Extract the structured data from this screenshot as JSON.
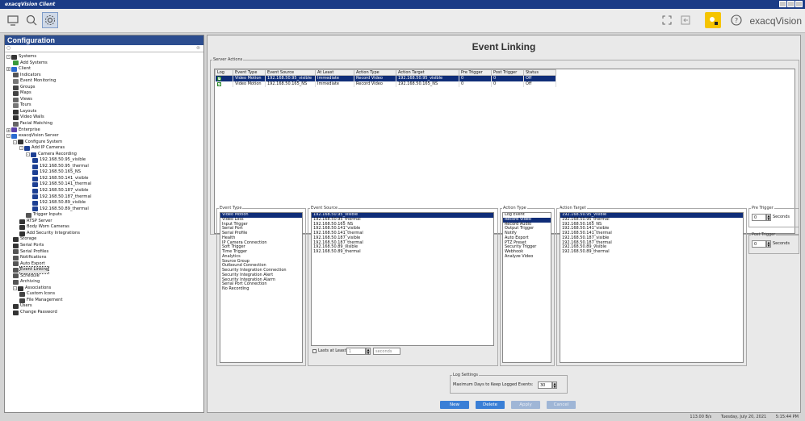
{
  "window": {
    "title": "exacqVision Client"
  },
  "brand": "exacqVision",
  "config_panel": {
    "title": "Configuration",
    "tree": [
      {
        "label": "Systems",
        "depth": 0,
        "exp": "-",
        "color": "#333"
      },
      {
        "label": "Add Systems",
        "depth": 1,
        "exp": "",
        "color": "#3a9a3a"
      },
      {
        "label": "Client",
        "depth": 0,
        "exp": "+",
        "color": "#2a6ad0"
      },
      {
        "label": "Indicators",
        "depth": 1,
        "exp": "",
        "color": "#555"
      },
      {
        "label": "Event Monitoring",
        "depth": 1,
        "exp": "",
        "color": "#777"
      },
      {
        "label": "Groups",
        "depth": 1,
        "exp": "",
        "color": "#444"
      },
      {
        "label": "Maps",
        "depth": 1,
        "exp": "",
        "color": "#444"
      },
      {
        "label": "Views",
        "depth": 1,
        "exp": "",
        "color": "#666"
      },
      {
        "label": "Tours",
        "depth": 1,
        "exp": "",
        "color": "#777"
      },
      {
        "label": "Layouts",
        "depth": 1,
        "exp": "",
        "color": "#333"
      },
      {
        "label": "Video Walls",
        "depth": 1,
        "exp": "",
        "color": "#333"
      },
      {
        "label": "Facial Matching",
        "depth": 1,
        "exp": "",
        "color": "#666"
      },
      {
        "label": "Enterprise",
        "depth": 0,
        "exp": "+",
        "color": "#5a3fa8"
      },
      {
        "label": "exacqVision Server",
        "depth": 0,
        "exp": "-",
        "color": "#2a6ad0"
      },
      {
        "label": "Configure System",
        "depth": 1,
        "exp": "-",
        "color": "#333"
      },
      {
        "label": "Add IP Cameras",
        "depth": 2,
        "exp": "-",
        "color": "#1c3f93"
      },
      {
        "label": "Camera Recording",
        "depth": 3,
        "exp": "-",
        "color": "#1c3f93"
      },
      {
        "label": "192.168.50.95_visible",
        "depth": 4,
        "exp": "",
        "color": "#1c3f93"
      },
      {
        "label": "192.168.50.95_thermal",
        "depth": 4,
        "exp": "",
        "color": "#1c3f93"
      },
      {
        "label": "192.168.50.165_NS",
        "depth": 4,
        "exp": "",
        "color": "#1c3f93"
      },
      {
        "label": "192.168.50.141_visible",
        "depth": 4,
        "exp": "",
        "color": "#1c3f93"
      },
      {
        "label": "192.168.50.141_thermal",
        "depth": 4,
        "exp": "",
        "color": "#1c3f93"
      },
      {
        "label": "192.168.50.187_visible",
        "depth": 4,
        "exp": "",
        "color": "#1c3f93"
      },
      {
        "label": "192.168.50.187_thermal",
        "depth": 4,
        "exp": "",
        "color": "#1c3f93"
      },
      {
        "label": "192.168.50.89_visible",
        "depth": 4,
        "exp": "",
        "color": "#1c3f93"
      },
      {
        "label": "192.168.50.89_thermal",
        "depth": 4,
        "exp": "",
        "color": "#1c3f93"
      },
      {
        "label": "Trigger Inputs",
        "depth": 3,
        "exp": "",
        "color": "#555"
      },
      {
        "label": "RTSP Server",
        "depth": 2,
        "exp": "",
        "color": "#333"
      },
      {
        "label": "Body Worn Cameras",
        "depth": 2,
        "exp": "",
        "color": "#333"
      },
      {
        "label": "Add Security Integrations",
        "depth": 2,
        "exp": "",
        "color": "#333"
      },
      {
        "label": "Storage",
        "depth": 1,
        "exp": "",
        "color": "#333"
      },
      {
        "label": "Serial Ports",
        "depth": 1,
        "exp": "",
        "color": "#333"
      },
      {
        "label": "Serial Profiles",
        "depth": 1,
        "exp": "",
        "color": "#555"
      },
      {
        "label": "Notifications",
        "depth": 1,
        "exp": "",
        "color": "#555"
      },
      {
        "label": "Auto Export",
        "depth": 1,
        "exp": "",
        "color": "#555"
      },
      {
        "label": "Event Linking",
        "depth": 1,
        "exp": "",
        "color": "#555",
        "selected": true
      },
      {
        "label": "Schedule",
        "depth": 1,
        "exp": "",
        "color": "#555"
      },
      {
        "label": "Archiving",
        "depth": 1,
        "exp": "",
        "color": "#555"
      },
      {
        "label": "Associations",
        "depth": 1,
        "exp": "-",
        "color": "#333"
      },
      {
        "label": "Custom Icons",
        "depth": 2,
        "exp": "",
        "color": "#444"
      },
      {
        "label": "File Management",
        "depth": 2,
        "exp": "",
        "color": "#444"
      },
      {
        "label": "Users",
        "depth": 1,
        "exp": "",
        "color": "#333"
      },
      {
        "label": "Change Password",
        "depth": 1,
        "exp": "",
        "color": "#333"
      }
    ]
  },
  "event_linking": {
    "title": "Event Linking",
    "server_actions_legend": "Server Actions",
    "columns": [
      "Log",
      "Event Type",
      "Event Source",
      "At Least",
      "Action Type",
      "Action Target",
      "Pre Trigger",
      "Post Trigger",
      "Status"
    ],
    "rows": [
      {
        "log": true,
        "event_type": "Video Motion",
        "event_source": "192.168.50.95_visible",
        "at_least": "Immediate",
        "action_type": "Record Video",
        "action_target": "192.168.50.95_visible",
        "pre": "0",
        "post": "0",
        "status": "Off",
        "selected": true
      },
      {
        "log": true,
        "event_type": "Video Motion",
        "event_source": "192.168.50.165_NS",
        "at_least": "Immediate",
        "action_type": "Record Video",
        "action_target": "192.168.50.165_NS",
        "pre": "0",
        "post": "0",
        "status": "Off",
        "selected": false
      }
    ],
    "event_type": {
      "legend": "Event Type",
      "items": [
        "Video Motion",
        "Video Loss",
        "Input Trigger",
        "Serial Port",
        "Serial Profile",
        "Health",
        "IP Camera Connection",
        "Soft Trigger",
        "Time Trigger",
        "Analytics",
        "Source Group",
        "Outbound Connection",
        "Security Integration Connection",
        "Security Integration Alert",
        "Security Integration Alarm",
        "Serial Port Connection",
        "No Recording"
      ],
      "selected": 0
    },
    "event_source": {
      "legend": "Event Source",
      "items": [
        "192.168.50.95_visible",
        "192.168.50.95_thermal",
        "192.168.50.165_NS",
        "192.168.50.141_visible",
        "192.168.50.141_thermal",
        "192.168.50.187_visible",
        "192.168.50.187_thermal",
        "192.168.50.89_visible",
        "192.168.50.89_thermal"
      ],
      "selected": 0,
      "lasts_label": "Lasts at Least:",
      "lasts_value": "1",
      "lasts_unit": "seconds"
    },
    "action_type": {
      "legend": "Action Type",
      "items": [
        "Log Event",
        "Record Video",
        "Record Audio",
        "Output Trigger",
        "Notify",
        "Auto Export",
        "PTZ Preset",
        "Security Trigger",
        "Webhook",
        "Analyze Video"
      ],
      "selected": 1
    },
    "action_target": {
      "legend": "Action Target",
      "items": [
        "192.168.50.95_visible",
        "192.168.50.95_thermal",
        "192.168.50.165_NS",
        "192.168.50.141_visible",
        "192.168.50.141_thermal",
        "192.168.50.187_visible",
        "192.168.50.187_thermal",
        "192.168.50.89_visible",
        "192.168.50.89_thermal"
      ],
      "selected": 0
    },
    "pre_trigger": {
      "legend": "Pre Trigger",
      "value": "0",
      "unit": "Seconds"
    },
    "post_trigger": {
      "legend": "Post Trigger",
      "value": "0",
      "unit": "Seconds"
    },
    "log_settings": {
      "legend": "Log Settings",
      "label": "Maximum Days to Keep Logged Events:",
      "value": "30"
    },
    "buttons": {
      "new": "New",
      "delete": "Delete",
      "apply": "Apply",
      "cancel": "Cancel"
    }
  },
  "status_bar": {
    "rate": "113.00 B/s",
    "date": "Tuesday, July 20, 2021",
    "time": "5:15:44 PM"
  },
  "colors": {
    "titlebar": "#1b3c86",
    "selection": "#0f2d78",
    "button": "#3a7fd6",
    "notify": "#f5c400"
  }
}
